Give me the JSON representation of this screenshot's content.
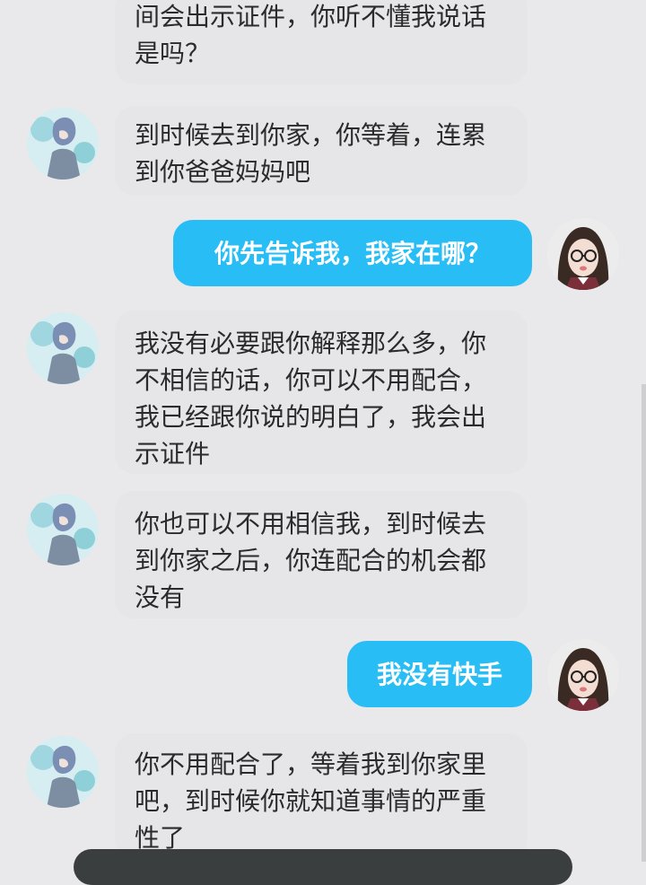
{
  "messages": [
    {
      "direction": "incoming",
      "text": "间会出示证件，你听不懂我说话是吗？"
    },
    {
      "direction": "incoming",
      "text": "到时候去到你家，你等着，连累到你爸爸妈妈吧"
    },
    {
      "direction": "outgoing",
      "text": "你先告诉我，我家在哪？"
    },
    {
      "direction": "incoming",
      "text": "我没有必要跟你解释那么多，你不相信的话，你可以不用配合，我已经跟你说的明白了，我会出示证件"
    },
    {
      "direction": "incoming",
      "text": "你也可以不用相信我，到时候去到你家之后，你连配合的机会都没有"
    },
    {
      "direction": "outgoing",
      "text": "我没有快手"
    },
    {
      "direction": "incoming",
      "text": "你不用配合了，等着我到你家里吧，到时候你就知道事情的严重性了"
    }
  ],
  "colors": {
    "background": "#e9e9eb",
    "incoming_bubble": "#e6e6e8",
    "outgoing_bubble": "#28bdf4"
  }
}
